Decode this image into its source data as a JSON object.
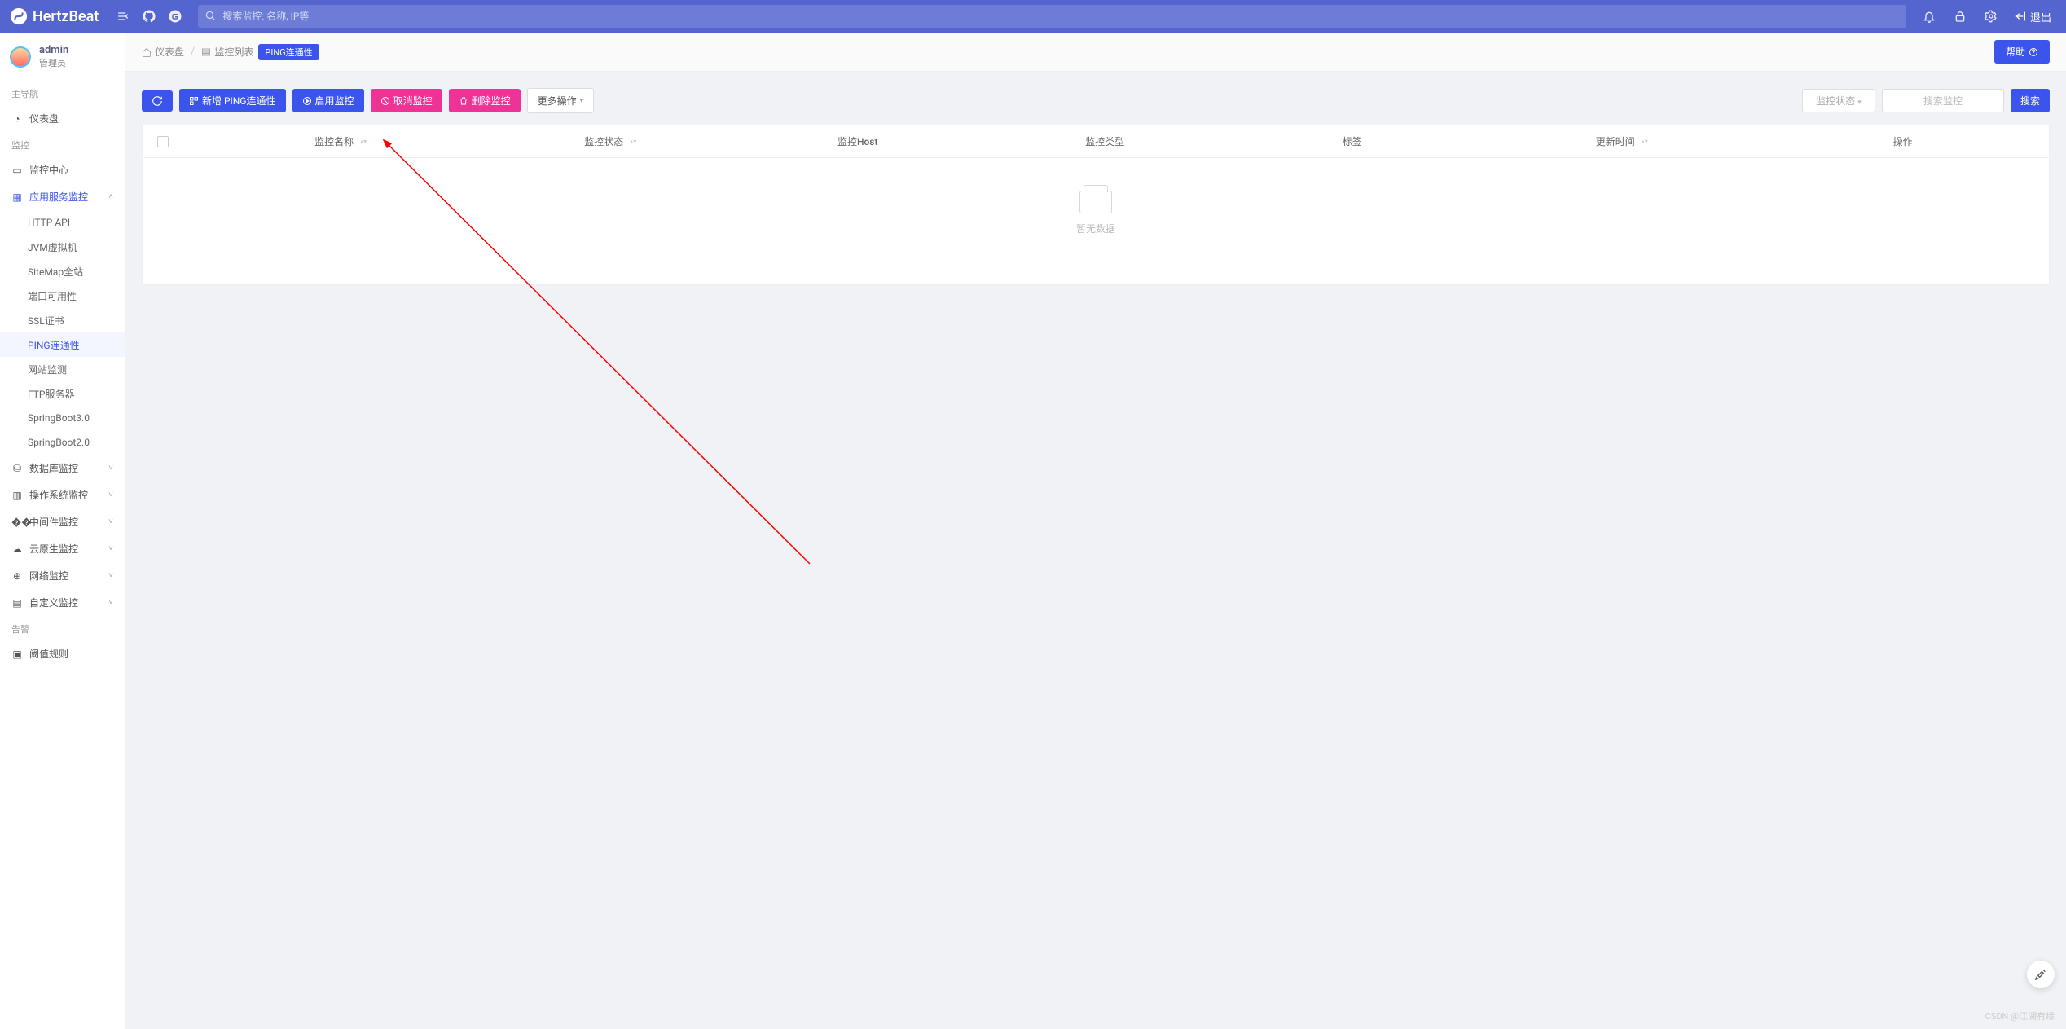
{
  "header": {
    "brand": "HertzBeat",
    "search_placeholder": "搜索监控: 名称, IP等",
    "logout_label": "退出"
  },
  "user": {
    "name": "admin",
    "role": "管理员"
  },
  "sidebar": {
    "section_main": "主导航",
    "dashboard": "仪表盘",
    "section_monitor": "监控",
    "monitor_center": "监控中心",
    "app_service": "应用服务监控",
    "subs": {
      "http": "HTTP API",
      "jvm": "JVM虚拟机",
      "sitemap": "SiteMap全站",
      "port": "端口可用性",
      "ssl": "SSL证书",
      "ping": "PING连通性",
      "website": "网站监测",
      "ftp": "FTP服务器",
      "sb3": "SpringBoot3.0",
      "sb2": "SpringBoot2.0"
    },
    "db": "数据库监控",
    "os": "操作系统监控",
    "mid": "中间件监控",
    "cloud": "云原生监控",
    "net": "网络监控",
    "custom": "自定义监控",
    "section_alert": "告警",
    "alert_rule": "阈值规则"
  },
  "breadcrumb": {
    "dash": "仪表盘",
    "list": "监控列表",
    "tag": "PING连通性",
    "help": "帮助"
  },
  "toolbar": {
    "add": "新增 PING连通性",
    "enable": "启用监控",
    "cancel": "取消监控",
    "delete": "删除监控",
    "more": "更多操作",
    "status_filter": "监控状态",
    "search_placeholder": "搜索监控",
    "search_btn": "搜索"
  },
  "table": {
    "cols": {
      "name": "监控名称",
      "status": "监控状态",
      "host": "监控Host",
      "type": "监控类型",
      "tags": "标签",
      "updated": "更新时间",
      "ops": "操作"
    },
    "empty": "暂无数据"
  },
  "watermark": "CSDN @江湖有缘"
}
